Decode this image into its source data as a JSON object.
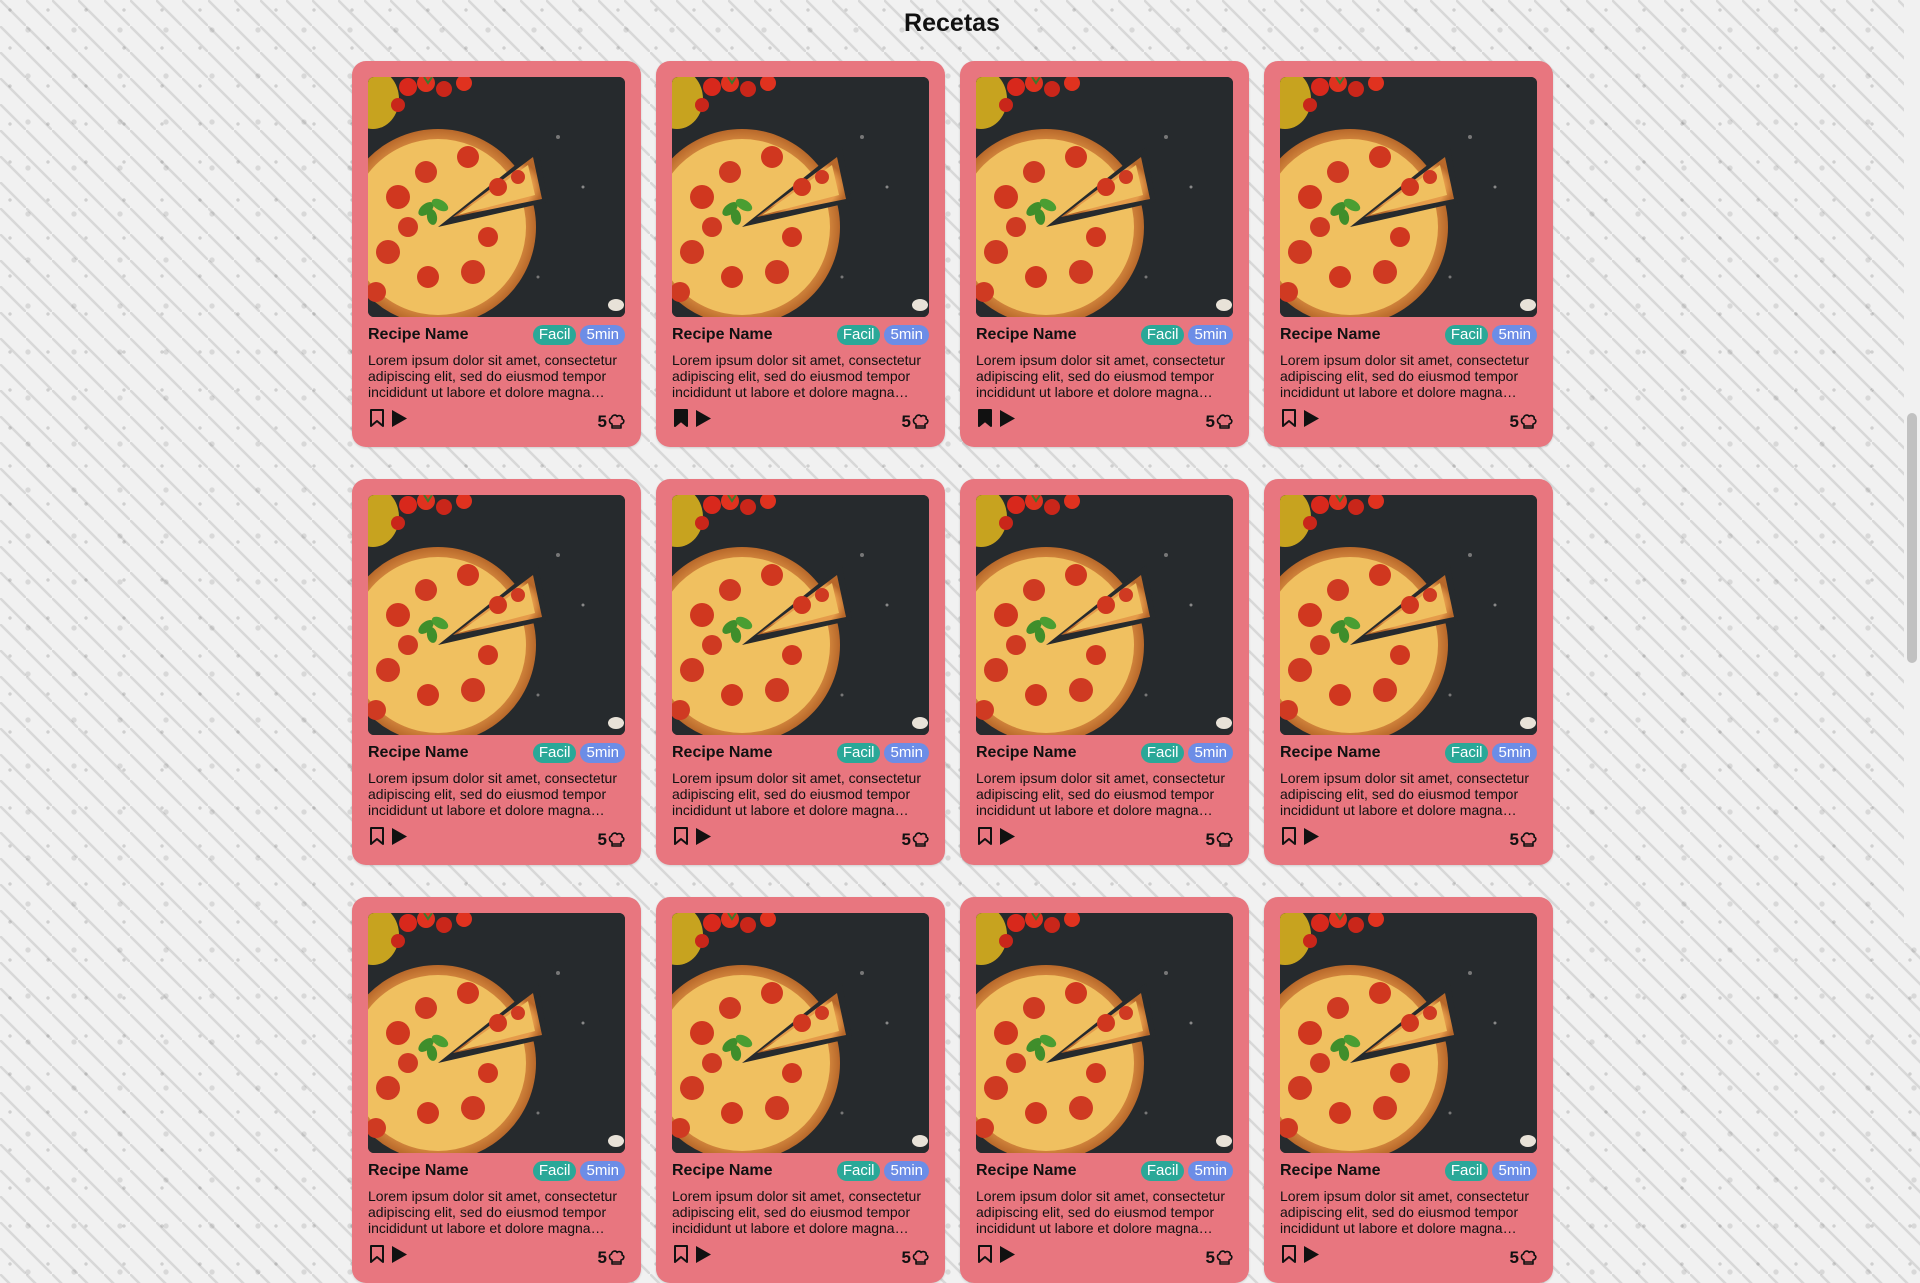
{
  "page": {
    "title": "Recetas"
  },
  "recipes": [
    {
      "name": "Recipe Name",
      "difficulty": "Facil",
      "time": "5min",
      "description": "Lorem ipsum dolor sit amet, consectetur adipiscing elit, sed do eiusmod tempor incididunt ut labore et dolore magna…",
      "rating": "5",
      "bookmarked": false,
      "image_icon": "pizza-image"
    },
    {
      "name": "Recipe Name",
      "difficulty": "Facil",
      "time": "5min",
      "description": "Lorem ipsum dolor sit amet, consectetur adipiscing elit, sed do eiusmod tempor incididunt ut labore et dolore magna…",
      "rating": "5",
      "bookmarked": true,
      "image_icon": "pizza-image"
    },
    {
      "name": "Recipe Name",
      "difficulty": "Facil",
      "time": "5min",
      "description": "Lorem ipsum dolor sit amet, consectetur adipiscing elit, sed do eiusmod tempor incididunt ut labore et dolore magna…",
      "rating": "5",
      "bookmarked": true,
      "image_icon": "pizza-image"
    },
    {
      "name": "Recipe Name",
      "difficulty": "Facil",
      "time": "5min",
      "description": "Lorem ipsum dolor sit amet, consectetur adipiscing elit, sed do eiusmod tempor incididunt ut labore et dolore magna…",
      "rating": "5",
      "bookmarked": false,
      "image_icon": "pizza-image"
    },
    {
      "name": "Recipe Name",
      "difficulty": "Facil",
      "time": "5min",
      "description": "Lorem ipsum dolor sit amet, consectetur adipiscing elit, sed do eiusmod tempor incididunt ut labore et dolore magna…",
      "rating": "5",
      "bookmarked": false,
      "image_icon": "pizza-image"
    },
    {
      "name": "Recipe Name",
      "difficulty": "Facil",
      "time": "5min",
      "description": "Lorem ipsum dolor sit amet, consectetur adipiscing elit, sed do eiusmod tempor incididunt ut labore et dolore magna…",
      "rating": "5",
      "bookmarked": false,
      "image_icon": "pizza-image"
    },
    {
      "name": "Recipe Name",
      "difficulty": "Facil",
      "time": "5min",
      "description": "Lorem ipsum dolor sit amet, consectetur adipiscing elit, sed do eiusmod tempor incididunt ut labore et dolore magna…",
      "rating": "5",
      "bookmarked": false,
      "image_icon": "pizza-image"
    },
    {
      "name": "Recipe Name",
      "difficulty": "Facil",
      "time": "5min",
      "description": "Lorem ipsum dolor sit amet, consectetur adipiscing elit, sed do eiusmod tempor incididunt ut labore et dolore magna…",
      "rating": "5",
      "bookmarked": false,
      "image_icon": "pizza-image"
    },
    {
      "name": "Recipe Name",
      "difficulty": "Facil",
      "time": "5min",
      "description": "Lorem ipsum dolor sit amet, consectetur adipiscing elit, sed do eiusmod tempor incididunt ut labore et dolore magna…",
      "rating": "5",
      "bookmarked": false,
      "image_icon": "pizza-image"
    },
    {
      "name": "Recipe Name",
      "difficulty": "Facil",
      "time": "5min",
      "description": "Lorem ipsum dolor sit amet, consectetur adipiscing elit, sed do eiusmod tempor incididunt ut labore et dolore magna…",
      "rating": "5",
      "bookmarked": false,
      "image_icon": "pizza-image"
    },
    {
      "name": "Recipe Name",
      "difficulty": "Facil",
      "time": "5min",
      "description": "Lorem ipsum dolor sit amet, consectetur adipiscing elit, sed do eiusmod tempor incididunt ut labore et dolore magna…",
      "rating": "5",
      "bookmarked": false,
      "image_icon": "pizza-image"
    },
    {
      "name": "Recipe Name",
      "difficulty": "Facil",
      "time": "5min",
      "description": "Lorem ipsum dolor sit amet, consectetur adipiscing elit, sed do eiusmod tempor incididunt ut labore et dolore magna…",
      "rating": "5",
      "bookmarked": false,
      "image_icon": "pizza-image"
    }
  ],
  "colors": {
    "card": "#e8767f",
    "badge_difficulty": "#2aa898",
    "badge_time": "#6c8de6"
  },
  "icons": {
    "bookmark": "bookmark-icon",
    "play": "play-icon",
    "rating": "chef-hat-icon"
  }
}
